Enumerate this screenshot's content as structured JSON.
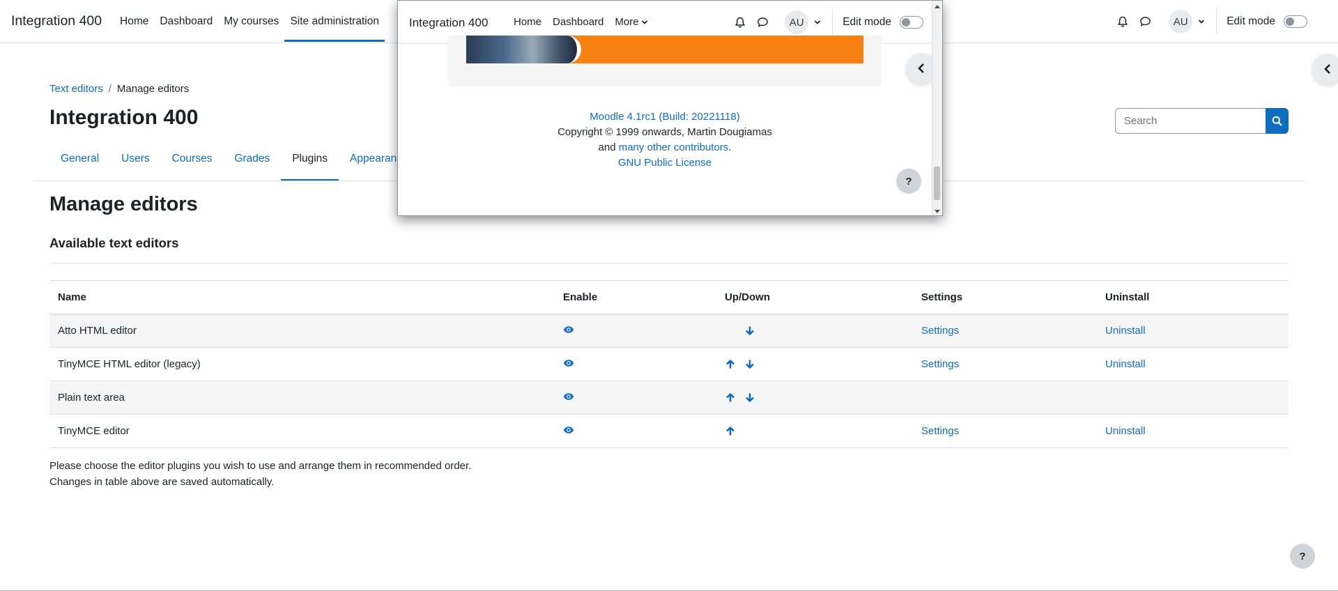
{
  "navbar": {
    "brand": "Integration 400",
    "links": [
      "Home",
      "Dashboard",
      "My courses",
      "Site administration"
    ],
    "avatar": "AU",
    "edit_mode": "Edit mode"
  },
  "breadcrumb": [
    "Text editors",
    "Manage editors"
  ],
  "page_title": "Integration 400",
  "search": {
    "placeholder": "Search"
  },
  "tabs": [
    "General",
    "Users",
    "Courses",
    "Grades",
    "Plugins",
    "Appearance"
  ],
  "main": {
    "heading": "Manage editors",
    "subheading": "Available text editors",
    "table": {
      "headers": [
        "Name",
        "Enable",
        "Up/Down",
        "Settings",
        "Uninstall"
      ],
      "rows": [
        {
          "name": "Atto HTML editor",
          "settings": "Settings",
          "uninstall": "Uninstall"
        },
        {
          "name": "TinyMCE HTML editor (legacy)",
          "settings": "Settings",
          "uninstall": "Uninstall"
        },
        {
          "name": "Plain text area",
          "settings": "",
          "uninstall": ""
        },
        {
          "name": "TinyMCE editor",
          "settings": "Settings",
          "uninstall": "Uninstall"
        }
      ]
    },
    "note_line1": "Please choose the editor plugins you wish to use and arrange them in recommended order.",
    "note_line2": "Changes in table above are saved automatically."
  },
  "help_label": "?",
  "popup": {
    "brand": "Integration 400",
    "links": [
      "Home",
      "Dashboard",
      "More"
    ],
    "avatar": "AU",
    "edit_mode": "Edit mode",
    "footer": {
      "version": "Moodle 4.1rc1 (Build: 20221118)",
      "copyright": "Copyright © 1999 onwards, Martin Dougiamas",
      "and": "and ",
      "contributors": "many other contributors",
      "period": ".",
      "license": "GNU Public License"
    }
  },
  "colors": {
    "primary": "#0f6cbf",
    "banner": "#f98012",
    "text": "#1d2125"
  }
}
